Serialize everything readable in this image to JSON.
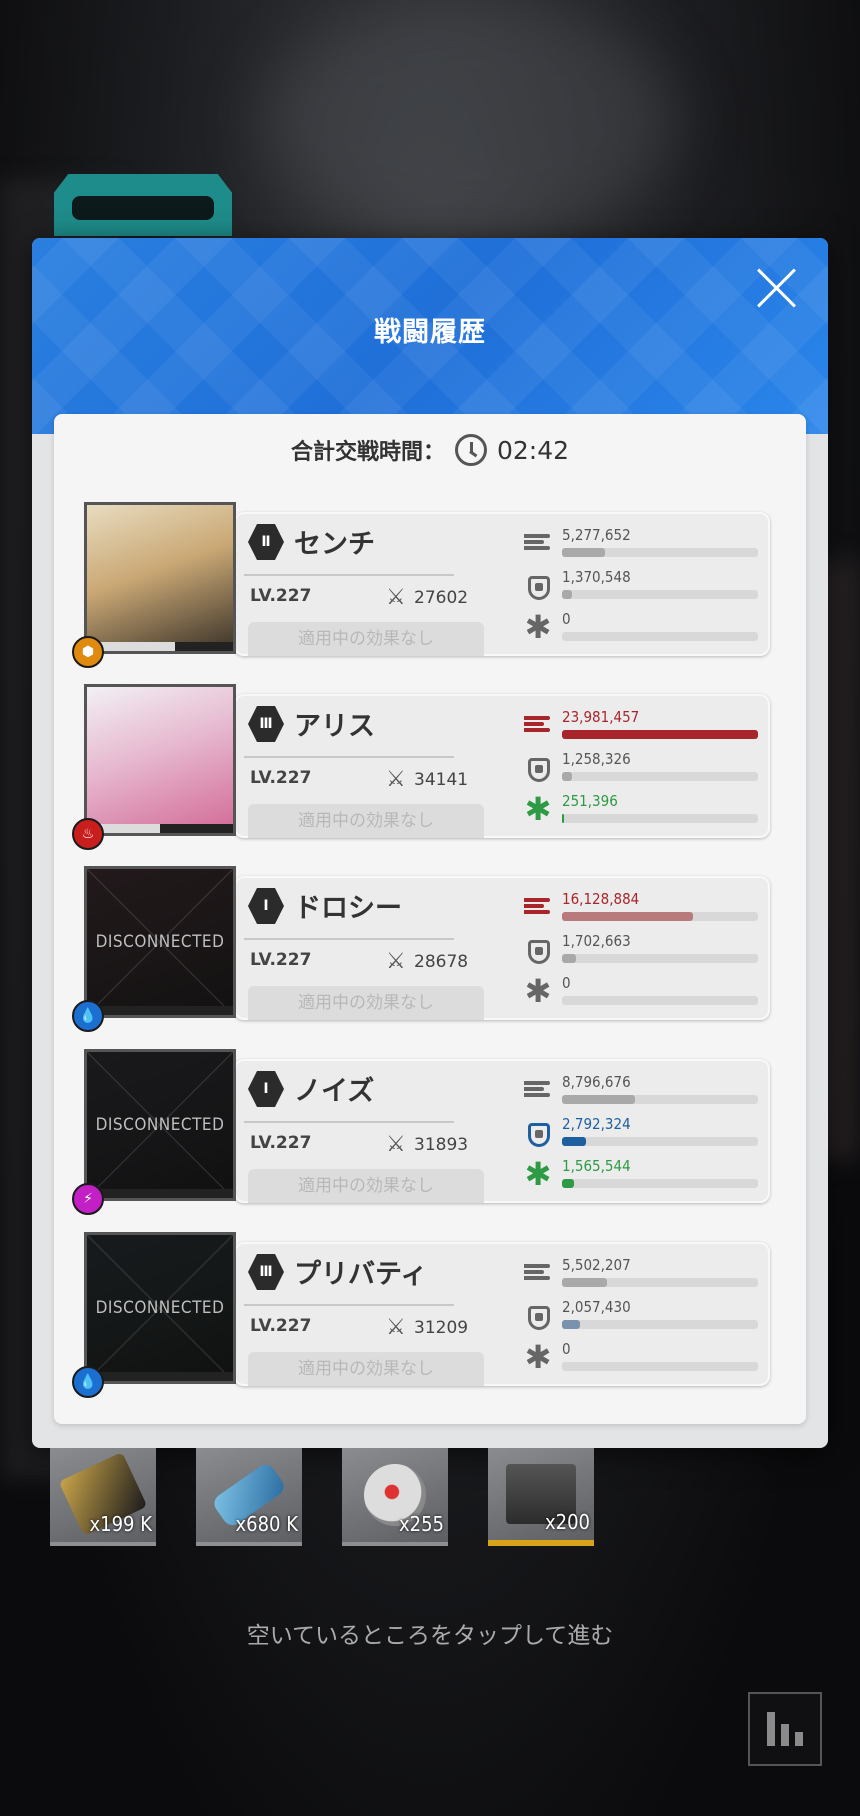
{
  "modal": {
    "title": "戦闘履歴",
    "total_time_label": "合計交戦時間：",
    "total_time_value": "02:42"
  },
  "colors": {
    "header_blue": "#1f6fd8",
    "damage_red": "#a8262b",
    "damage_pink": "#b97a7c",
    "shield_blue": "#1f5fa0",
    "heal_green": "#2f9a45",
    "bar_gray": "#a9a9a9"
  },
  "units": [
    {
      "burst": "Ⅱ",
      "name": "センチ",
      "level": "LV.227",
      "power": "27602",
      "effect": "適用中の効果なし",
      "element": "iron-element-icon",
      "element_color": "#e08a10",
      "disconnected": false,
      "disconnected_label": "",
      "hp_fraction": 0.6,
      "stats": [
        {
          "type": "damage",
          "value": "5,277,652",
          "fraction": 0.22,
          "color": "#a9a9a9",
          "value_color": "#555"
        },
        {
          "type": "shield",
          "value": "1,370,548",
          "fraction": 0.05,
          "color": "#a9a9a9",
          "value_color": "#555"
        },
        {
          "type": "heal",
          "value": "0",
          "fraction": 0,
          "color": "#a9a9a9",
          "value_color": "#555"
        }
      ]
    },
    {
      "burst": "Ⅲ",
      "name": "アリス",
      "level": "LV.227",
      "power": "34141",
      "effect": "適用中の効果なし",
      "element": "fire-element-icon",
      "element_color": "#c81e1e",
      "disconnected": false,
      "disconnected_label": "",
      "hp_fraction": 0.5,
      "stats": [
        {
          "type": "damage",
          "value": "23,981,457",
          "fraction": 1.0,
          "color": "#a8262b",
          "value_color": "#a8262b"
        },
        {
          "type": "shield",
          "value": "1,258,326",
          "fraction": 0.05,
          "color": "#a9a9a9",
          "value_color": "#555"
        },
        {
          "type": "heal",
          "value": "251,396",
          "fraction": 0.01,
          "color": "#2f9a45",
          "value_color": "#2f9a45"
        }
      ]
    },
    {
      "burst": "Ⅰ",
      "name": "ドロシー",
      "level": "LV.227",
      "power": "28678",
      "effect": "適用中の効果なし",
      "element": "water-element-icon",
      "element_color": "#1b6fd1",
      "disconnected": true,
      "disconnected_label": "DISCONNECTED",
      "hp_fraction": 0,
      "stats": [
        {
          "type": "damage",
          "value": "16,128,884",
          "fraction": 0.67,
          "color": "#b97a7c",
          "value_color": "#a8262b"
        },
        {
          "type": "shield",
          "value": "1,702,663",
          "fraction": 0.07,
          "color": "#a9a9a9",
          "value_color": "#555"
        },
        {
          "type": "heal",
          "value": "0",
          "fraction": 0,
          "color": "#a9a9a9",
          "value_color": "#555"
        }
      ]
    },
    {
      "burst": "Ⅰ",
      "name": "ノイズ",
      "level": "LV.227",
      "power": "31893",
      "effect": "適用中の効果なし",
      "element": "electric-element-icon",
      "element_color": "#c21fc4",
      "disconnected": true,
      "disconnected_label": "DISCONNECTED",
      "hp_fraction": 0,
      "stats": [
        {
          "type": "damage",
          "value": "8,796,676",
          "fraction": 0.37,
          "color": "#a9a9a9",
          "value_color": "#555"
        },
        {
          "type": "shield",
          "value": "2,792,324",
          "fraction": 0.12,
          "color": "#1f5fa0",
          "value_color": "#1f5fa0"
        },
        {
          "type": "heal",
          "value": "1,565,544",
          "fraction": 0.06,
          "color": "#2f9a45",
          "value_color": "#2f9a45"
        }
      ]
    },
    {
      "burst": "Ⅲ",
      "name": "プリバティ",
      "level": "LV.227",
      "power": "31209",
      "effect": "適用中の効果なし",
      "element": "water-element-icon",
      "element_color": "#1b6fd1",
      "disconnected": true,
      "disconnected_label": "DISCONNECTED",
      "hp_fraction": 0,
      "stats": [
        {
          "type": "damage",
          "value": "5,502,207",
          "fraction": 0.23,
          "color": "#a9a9a9",
          "value_color": "#555"
        },
        {
          "type": "shield",
          "value": "2,057,430",
          "fraction": 0.09,
          "color": "#7a92ad",
          "value_color": "#555"
        },
        {
          "type": "heal",
          "value": "0",
          "fraction": 0,
          "color": "#a9a9a9",
          "value_color": "#555"
        }
      ]
    }
  ],
  "rewards": [
    {
      "name": "credit-card-icon",
      "count": "x199 K"
    },
    {
      "name": "battle-data-usb-icon",
      "count": "x680 K"
    },
    {
      "name": "core-dust-orb-icon",
      "count": "x255"
    },
    {
      "name": "supply-crate-icon",
      "count": "x200"
    }
  ],
  "hint": "空いているところをタップして進む",
  "stats_button_icon": "bar-chart-icon"
}
